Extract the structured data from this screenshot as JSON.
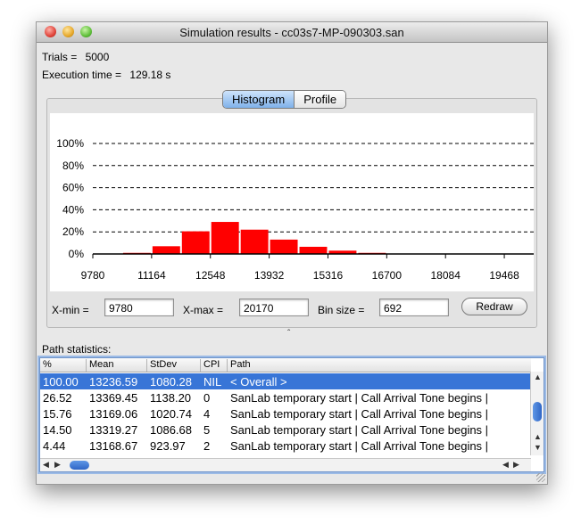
{
  "window": {
    "title": "Simulation results - cc03s7-MP-090303.san"
  },
  "summary": {
    "trials_label": "Trials =",
    "trials_value": "5000",
    "exec_label": "Execution time =",
    "exec_value": "129.18 s"
  },
  "tabs": [
    {
      "label": "Histogram",
      "selected": true
    },
    {
      "label": "Profile",
      "selected": false
    }
  ],
  "chart_data": {
    "type": "bar",
    "y_ticks": [
      "0%",
      "20%",
      "40%",
      "60%",
      "80%",
      "100%"
    ],
    "ylim": [
      0,
      100
    ],
    "x_tick_labels": [
      "9780",
      "11164",
      "12548",
      "13932",
      "15316",
      "16700",
      "18084",
      "19468"
    ],
    "bin_width": 692,
    "x_min": 9780,
    "bins": [
      {
        "start": 9780,
        "value": 0.1
      },
      {
        "start": 10472,
        "value": 1
      },
      {
        "start": 11164,
        "value": 7
      },
      {
        "start": 11856,
        "value": 20.5
      },
      {
        "start": 12548,
        "value": 29
      },
      {
        "start": 13240,
        "value": 22
      },
      {
        "start": 13932,
        "value": 13
      },
      {
        "start": 14624,
        "value": 6.5
      },
      {
        "start": 15316,
        "value": 3
      },
      {
        "start": 16008,
        "value": 1
      },
      {
        "start": 16700,
        "value": 0.3
      },
      {
        "start": 17392,
        "value": 0.1
      },
      {
        "start": 18084,
        "value": 0
      },
      {
        "start": 18776,
        "value": 0
      },
      {
        "start": 19468,
        "value": 0
      }
    ],
    "bar_color": "#ff0000",
    "grid": "dashed horizontal"
  },
  "controls": {
    "xmin_label": "X-min =",
    "xmin_value": "9780",
    "xmax_label": "X-max =",
    "xmax_value": "20170",
    "bin_label": "Bin size =",
    "bin_value": "692",
    "redraw_label": "Redraw"
  },
  "path_stats": {
    "label": "Path statistics:",
    "columns": [
      "%",
      "Mean",
      "StDev",
      "CPI",
      "Path"
    ],
    "rows": [
      {
        "pct": "100.00",
        "mean": "13236.59",
        "stdev": "1080.28",
        "cpi": "NIL",
        "path": "< Overall >",
        "selected": true
      },
      {
        "pct": "26.52",
        "mean": "13369.45",
        "stdev": "1138.20",
        "cpi": "0",
        "path": "SanLab temporary start  |  Call Arrival Tone begins  |"
      },
      {
        "pct": "15.76",
        "mean": "13169.06",
        "stdev": "1020.74",
        "cpi": "4",
        "path": "SanLab temporary start  |  Call Arrival Tone begins  |"
      },
      {
        "pct": "14.50",
        "mean": "13319.27",
        "stdev": "1086.68",
        "cpi": "5",
        "path": "SanLab temporary start  |  Call Arrival Tone begins  |"
      },
      {
        "pct": "4.44",
        "mean": "13168.67",
        "stdev": "923.97",
        "cpi": "2",
        "path": "SanLab temporary start  |  Call Arrival Tone begins  |"
      }
    ]
  },
  "colors": {
    "selection": "#3875d7",
    "accent": "#7fb1ea"
  }
}
